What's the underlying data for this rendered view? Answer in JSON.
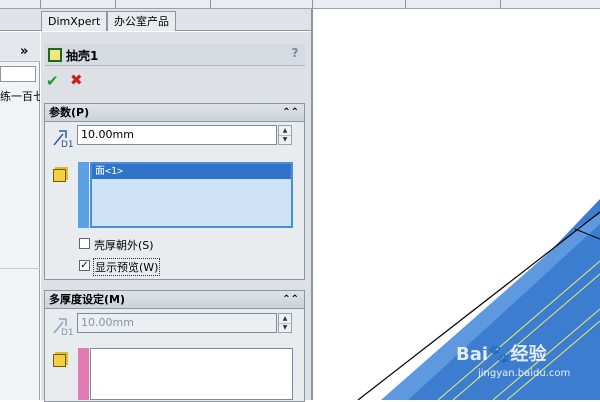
{
  "tabs": [
    "DimXpert",
    "办公室产品"
  ],
  "tree": {
    "chevron": "»",
    "truncated_text": "练一百七"
  },
  "feature": {
    "title": "抽壳1",
    "help": "?",
    "ok": "✔",
    "cancel": "✖"
  },
  "params_group": {
    "title": "参数(P)",
    "thickness": "10.00mm",
    "dim_label": "D1",
    "faces": [
      "面<1>"
    ],
    "shell_outward": "壳厚朝外(S)",
    "show_preview": "显示预览(W)",
    "show_preview_checked": true,
    "shell_outward_checked": false
  },
  "multi_group": {
    "title": "多厚度设定(M)",
    "thickness": "10.00mm",
    "dim_label": "D1"
  },
  "watermark": {
    "brand": "Bai",
    "brand2": "经验",
    "url": "jingyan.baidu.com"
  },
  "colors": {
    "selected_face": "#4a8fd9",
    "list_highlight": "#cfe3f7",
    "pink_strip": "#e27bb1",
    "blue_strip": "#5aa0e3",
    "model_blue": "#3c7dd0"
  }
}
